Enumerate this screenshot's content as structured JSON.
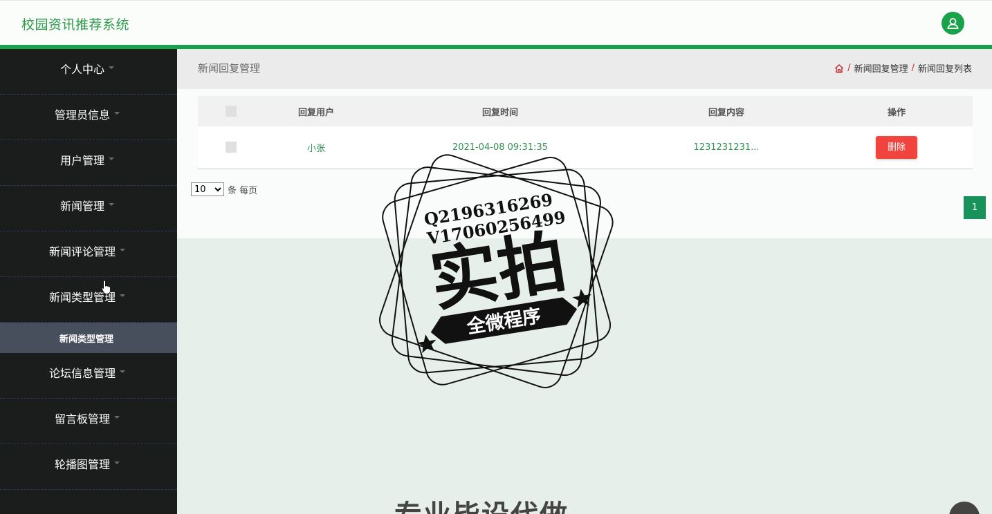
{
  "app": {
    "title": "校园资讯推荐系统"
  },
  "sidebar": {
    "items": [
      {
        "label": "个人中心"
      },
      {
        "label": "管理员信息"
      },
      {
        "label": "用户管理"
      },
      {
        "label": "新闻管理"
      },
      {
        "label": "新闻评论管理"
      },
      {
        "label": "新闻类型管理"
      },
      {
        "label": "论坛信息管理"
      },
      {
        "label": "留言板管理"
      },
      {
        "label": "轮播图管理"
      }
    ],
    "active_submenu": "新闻类型管理"
  },
  "page": {
    "title": "新闻回复管理",
    "breadcrumb": [
      "新闻回复管理",
      "新闻回复列表"
    ]
  },
  "table": {
    "columns": [
      "回复用户",
      "回复时间",
      "回复内容",
      "操作"
    ],
    "rows": [
      {
        "user": "小张",
        "time": "2021-04-08 09:31:35",
        "content": "1231231231...",
        "action": "删除"
      }
    ]
  },
  "pagination": {
    "page_size": "10",
    "page_size_suffix": "条 每页",
    "current_page": "1"
  },
  "watermark": {
    "line1": "Q2196316269",
    "line2": "V17060256499",
    "big": "实拍",
    "banner": "全微程序",
    "bottom": "专业毕设代做"
  }
}
